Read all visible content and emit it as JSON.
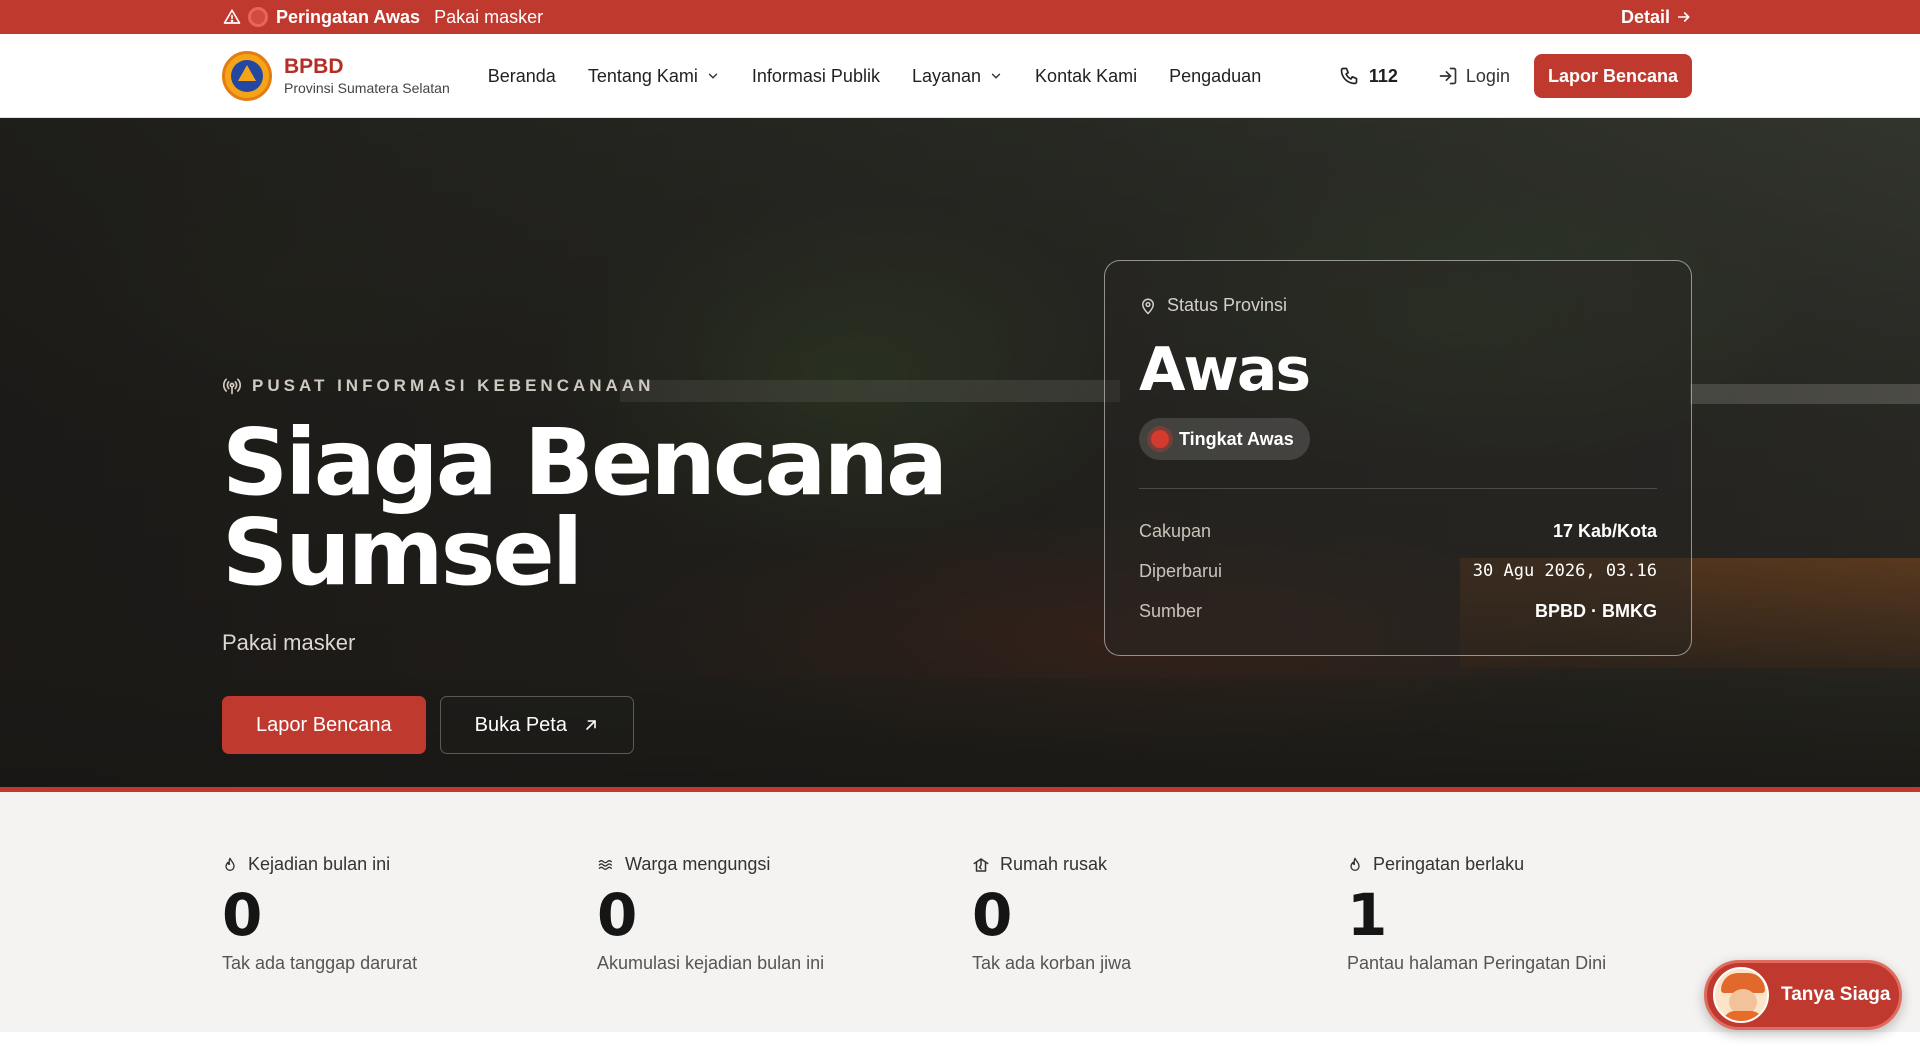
{
  "alert": {
    "title": "Peringatan Awas",
    "message": "Pakai masker",
    "detail_label": "Detail"
  },
  "header": {
    "brand_name": "BPBD",
    "brand_sub": "Provinsi Sumatera Selatan",
    "nav": [
      {
        "label": "Beranda",
        "dropdown": false
      },
      {
        "label": "Tentang Kami",
        "dropdown": true
      },
      {
        "label": "Informasi Publik",
        "dropdown": false
      },
      {
        "label": "Layanan",
        "dropdown": true
      },
      {
        "label": "Kontak Kami",
        "dropdown": false
      },
      {
        "label": "Pengaduan",
        "dropdown": false
      }
    ],
    "phone": "112",
    "login_label": "Login",
    "report_label": "Lapor Bencana"
  },
  "hero": {
    "eyebrow": "PUSAT INFORMASI KEBENCANAAN",
    "title_line1": "Siaga Bencana",
    "title_line2": "Sumsel",
    "subtitle": "Pakai masker",
    "primary_button": "Lapor Bencana",
    "secondary_button": "Buka Peta"
  },
  "status": {
    "heading": "Status Provinsi",
    "level": "Awas",
    "pill": "Tingkat Awas",
    "rows": [
      {
        "key": "Cakupan",
        "value": "17 Kab/Kota"
      },
      {
        "key": "Diperbarui",
        "value": "30 Agu 2026, 03.16"
      },
      {
        "key": "Sumber",
        "value": "BPBD · BMKG"
      }
    ]
  },
  "stats": [
    {
      "icon": "flame-icon",
      "label": "Kejadian bulan ini",
      "value": "0",
      "note": "Tak ada tanggap darurat"
    },
    {
      "icon": "waves-icon",
      "label": "Warga mengungsi",
      "value": "0",
      "note": "Akumulasi kejadian bulan ini"
    },
    {
      "icon": "house-damage-icon",
      "label": "Rumah rusak",
      "value": "0",
      "note": "Tak ada korban jiwa"
    },
    {
      "icon": "flame-icon",
      "label": "Peringatan berlaku",
      "value": "1",
      "note": "Pantau halaman Peringatan Dini"
    }
  ],
  "chat": {
    "label": "Tanya Siaga"
  },
  "colors": {
    "brand_red": "#c0392f",
    "alert_bar": "#c0392f",
    "hero_dark": "#2d2d28"
  }
}
